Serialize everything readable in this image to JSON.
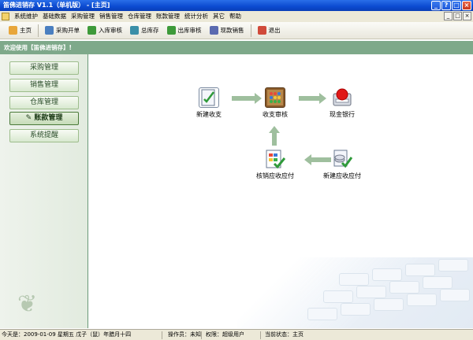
{
  "window": {
    "title": "笛佛进销存 V1.1（单机版） - [主页]",
    "buttons": [
      "_",
      "?",
      "□",
      "×"
    ]
  },
  "menubar": {
    "items": [
      "系统维护",
      "基础数据",
      "采购管理",
      "销售管理",
      "仓库管理",
      "账款管理",
      "统计分析",
      "其它",
      "帮助"
    ],
    "mdi_buttons": [
      "_",
      "□",
      "×"
    ]
  },
  "toolbar": {
    "items": [
      {
        "label": "主页",
        "icon": "home-icon",
        "color": "#e8a63a"
      },
      {
        "label": "采购开单",
        "icon": "purchase-order-icon",
        "color": "#4a7fc0"
      },
      {
        "label": "入库审核",
        "icon": "stock-in-icon",
        "color": "#3d9a3a"
      },
      {
        "label": "总库存",
        "icon": "inventory-icon",
        "color": "#3a8fa8"
      },
      {
        "label": "出库审核",
        "icon": "stock-out-icon",
        "color": "#3d9a3a"
      },
      {
        "label": "现款销售",
        "icon": "cash-sale-icon",
        "color": "#5a6ab0"
      },
      {
        "label": "退出",
        "icon": "exit-icon",
        "color": "#d04a3a"
      }
    ]
  },
  "welcome": {
    "text": "欢迎使用【笛佛进销存】!"
  },
  "sidebar": {
    "items": [
      {
        "label": "采购管理",
        "active": false
      },
      {
        "label": "销售管理",
        "active": false
      },
      {
        "label": "仓库管理",
        "active": false
      },
      {
        "label": "账款管理",
        "active": true
      },
      {
        "label": "系统提醒",
        "active": false
      }
    ]
  },
  "flow": {
    "nodes": [
      {
        "label": "新建收支",
        "icon": "new-income-expense-icon"
      },
      {
        "label": "收支审核",
        "icon": "income-expense-audit-icon"
      },
      {
        "label": "现金银行",
        "icon": "cash-bank-icon"
      },
      {
        "label": "核销应收应付",
        "icon": "write-off-receivable-payable-icon"
      },
      {
        "label": "新建应收应付",
        "icon": "new-receivable-payable-icon"
      }
    ]
  },
  "statusbar": {
    "date": "今天是：2009-01-09 星期五 戊子（鼠）年腊月十四",
    "operator": "操作员：未知",
    "permission": "权限：超级用户",
    "state": "当前状态：主页"
  }
}
